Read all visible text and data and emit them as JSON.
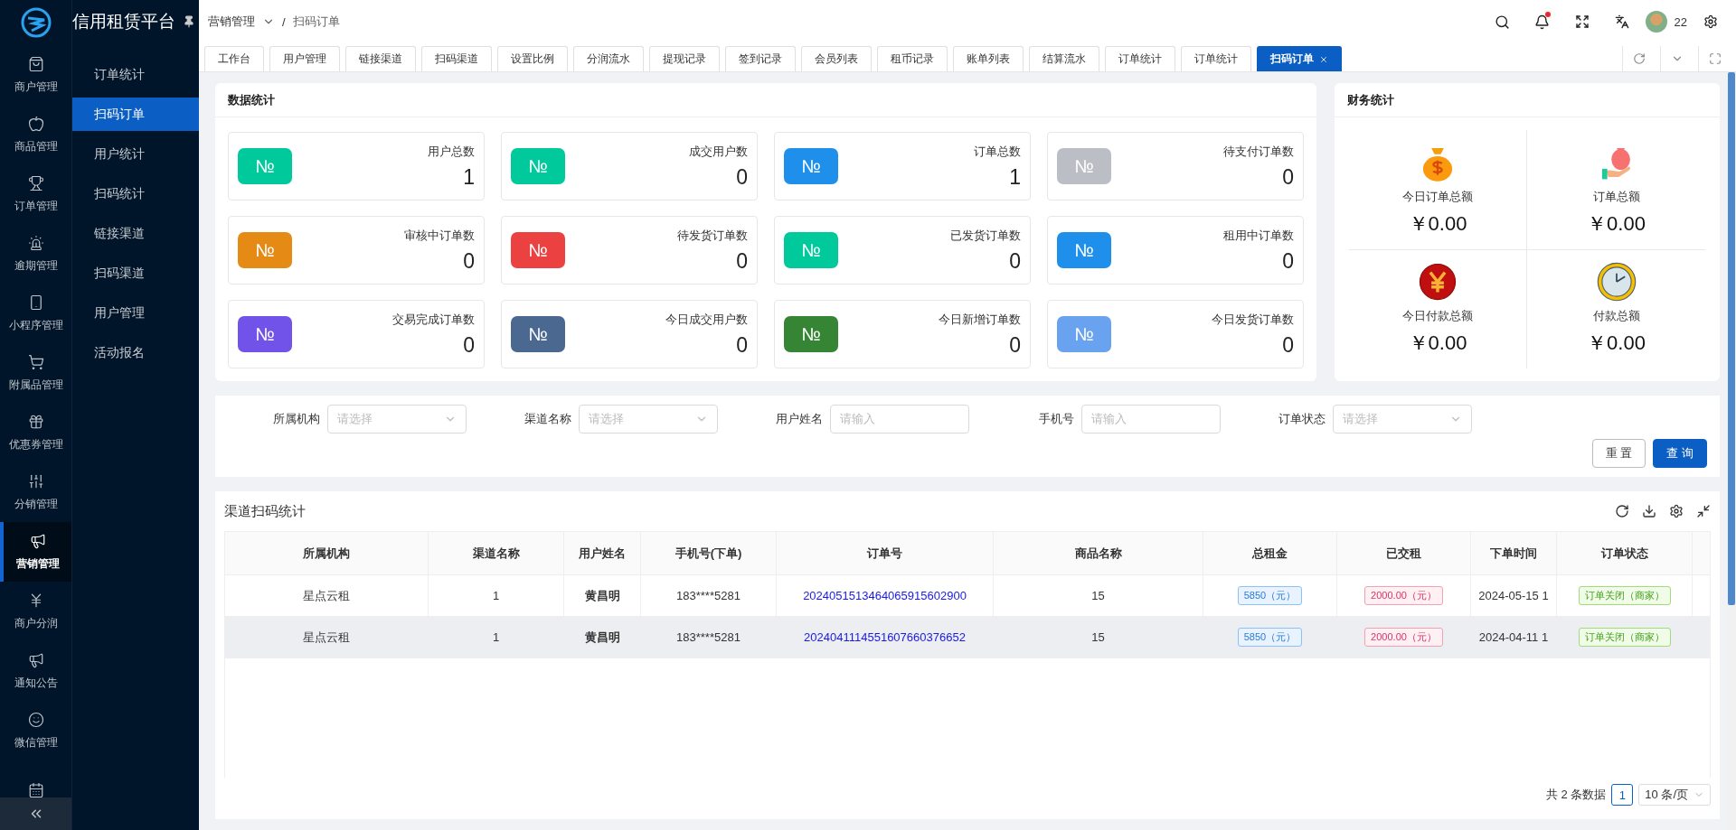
{
  "brand": {
    "title": "信用租赁平台"
  },
  "rail": [
    {
      "label": "商户管理",
      "selected": false
    },
    {
      "label": "商品管理",
      "selected": false
    },
    {
      "label": "订单管理",
      "selected": false
    },
    {
      "label": "逾期管理",
      "selected": false
    },
    {
      "label": "小程序管理",
      "selected": false
    },
    {
      "label": "附属品管理",
      "selected": false
    },
    {
      "label": "优惠券管理",
      "selected": false
    },
    {
      "label": "分销管理",
      "selected": false
    },
    {
      "label": "营销管理",
      "selected": true
    },
    {
      "label": "商户分润",
      "selected": false
    },
    {
      "label": "通知公告",
      "selected": false
    },
    {
      "label": "微信管理",
      "selected": false
    },
    {
      "selected": false
    }
  ],
  "submenu": [
    {
      "label": "订单统计",
      "selected": false
    },
    {
      "label": "扫码订单",
      "selected": true
    },
    {
      "label": "用户统计",
      "selected": false
    },
    {
      "label": "扫码统计",
      "selected": false
    },
    {
      "label": "链接渠道",
      "selected": false
    },
    {
      "label": "扫码渠道",
      "selected": false
    },
    {
      "label": "用户管理",
      "selected": false
    },
    {
      "label": "活动报名",
      "selected": false
    }
  ],
  "breadcrumb": [
    "营销管理",
    "扫码订单"
  ],
  "breadcrumb_separator": "/",
  "header": {
    "user_count": "22",
    "has_notification": true
  },
  "tabs": [
    {
      "label": "工作台",
      "selected": false
    },
    {
      "label": "用户管理",
      "selected": false
    },
    {
      "label": "链接渠道",
      "selected": false
    },
    {
      "label": "扫码渠道",
      "selected": false
    },
    {
      "label": "设置比例",
      "selected": false
    },
    {
      "label": "分润流水",
      "selected": false
    },
    {
      "label": "提现记录",
      "selected": false
    },
    {
      "label": "签到记录",
      "selected": false
    },
    {
      "label": "会员列表",
      "selected": false
    },
    {
      "label": "租币记录",
      "selected": false
    },
    {
      "label": "账单列表",
      "selected": false
    },
    {
      "label": "结算流水",
      "selected": false
    },
    {
      "label": "订单统计",
      "selected": false
    },
    {
      "label": "订单统计",
      "selected": false
    },
    {
      "label": "扫码订单",
      "selected": true
    }
  ],
  "stats": {
    "title": "数据统计",
    "items": [
      {
        "badge": "№",
        "label": "用户总数",
        "value": "1",
        "color": "#00c99b"
      },
      {
        "badge": "№",
        "label": "成交用户数",
        "value": "0",
        "color": "#00c99b"
      },
      {
        "badge": "№",
        "label": "订单总数",
        "value": "1",
        "color": "#1e90ec"
      },
      {
        "badge": "№",
        "label": "待支付订单数",
        "value": "0",
        "color": "#bbbec4"
      },
      {
        "badge": "№",
        "label": "审核中订单数",
        "value": "0",
        "color": "#e68a16"
      },
      {
        "badge": "№",
        "label": "待发货订单数",
        "value": "0",
        "color": "#ec4141"
      },
      {
        "badge": "№",
        "label": "已发货订单数",
        "value": "0",
        "color": "#00c99b"
      },
      {
        "badge": "№",
        "label": "租用中订单数",
        "value": "0",
        "color": "#1e90ec"
      },
      {
        "badge": "№",
        "label": "交易完成订单数",
        "value": "0",
        "color": "#7153e9"
      },
      {
        "badge": "№",
        "label": "今日成交用户数",
        "value": "0",
        "color": "#4a6890"
      },
      {
        "badge": "№",
        "label": "今日新增订单数",
        "value": "0",
        "color": "#358535"
      },
      {
        "badge": "№",
        "label": "今日发货订单数",
        "value": "0",
        "color": "#69a2ee"
      }
    ]
  },
  "finance": {
    "title": "财务统计",
    "items": [
      {
        "label": "今日订单总额",
        "amount": "￥0.00"
      },
      {
        "label": "订单总额",
        "amount": "￥0.00"
      },
      {
        "label": "今日付款总额",
        "amount": "￥0.00"
      },
      {
        "label": "付款总额",
        "amount": "￥0.00"
      }
    ]
  },
  "filters": [
    {
      "label": "所属机构",
      "kind": "select",
      "placeholder": "请选择"
    },
    {
      "label": "渠道名称",
      "kind": "select",
      "placeholder": "请选择"
    },
    {
      "label": "用户姓名",
      "kind": "input",
      "placeholder": "请输入"
    },
    {
      "label": "手机号",
      "kind": "input",
      "placeholder": "请输入"
    },
    {
      "label": "订单状态",
      "kind": "select",
      "placeholder": "请选择"
    }
  ],
  "filter_buttons": [
    "重 置",
    "查 询"
  ],
  "table": {
    "title": "渠道扫码统计",
    "columns": [
      {
        "label": "所属机构",
        "kind": "text"
      },
      {
        "label": "渠道名称",
        "kind": "text"
      },
      {
        "label": "用户姓名",
        "kind": "bold"
      },
      {
        "label": "手机号(下单)",
        "kind": "text"
      },
      {
        "label": "订单号",
        "kind": "link"
      },
      {
        "label": "商品名称",
        "kind": "text"
      },
      {
        "label": "总租金",
        "kind": "blue-tag"
      },
      {
        "label": "已交租",
        "kind": "pink-tag"
      },
      {
        "label": "下单时间",
        "kind": "text"
      },
      {
        "label": "订单状态",
        "kind": "green-tag"
      }
    ],
    "rows": [
      {
        "selected": false,
        "cells": [
          "星点云租",
          "1",
          "黄昌明",
          "183****5281",
          "2024051513464065915602900",
          "15",
          "5850（元）",
          "2000.00（元）",
          "2024-05-15 1",
          "订单关闭（商家）"
        ]
      },
      {
        "selected": true,
        "cells": [
          "星点云租",
          "1",
          "黄昌明",
          "183****5281",
          "2024041114551607660376652",
          "15",
          "5850（元）",
          "2000.00（元）",
          "2024-04-11 1",
          "订单关闭（商家）"
        ]
      }
    ]
  },
  "pagination": {
    "total": "共 2 条数据",
    "pages": [
      {
        "label": "1",
        "selected": true
      }
    ],
    "page_size": "10 条/页"
  }
}
